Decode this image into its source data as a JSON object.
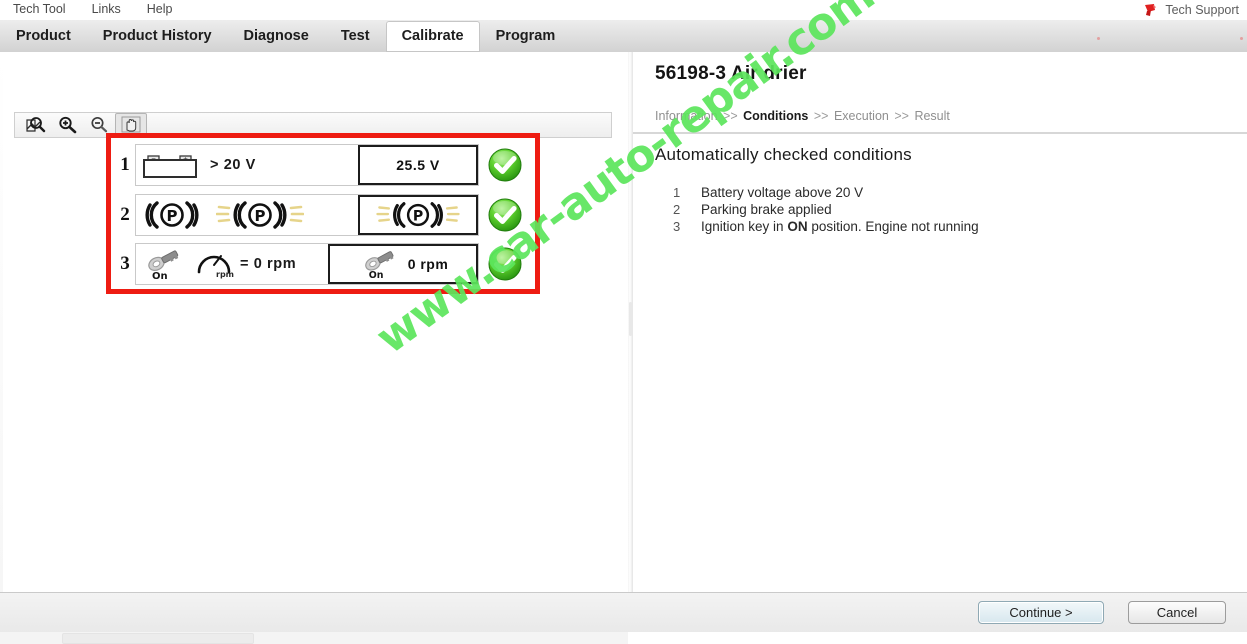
{
  "menubar": {
    "items": [
      {
        "label": "Tech Tool"
      },
      {
        "label": "Links"
      },
      {
        "label": "Help"
      }
    ],
    "tech_support": {
      "label": "Tech Support",
      "icon": "tech-support-icon"
    }
  },
  "tabs": [
    {
      "label": "Product",
      "active": false
    },
    {
      "label": "Product History",
      "active": false
    },
    {
      "label": "Diagnose",
      "active": false
    },
    {
      "label": "Test",
      "active": false
    },
    {
      "label": "Calibrate",
      "active": true
    },
    {
      "label": "Program",
      "active": false
    }
  ],
  "graphic_toolbar": {
    "buttons": [
      {
        "name": "zoom-fit-icon",
        "title": "Zoom to fit"
      },
      {
        "name": "zoom-in-icon",
        "title": "Zoom in"
      },
      {
        "name": "zoom-out-icon",
        "title": "Zoom out"
      },
      {
        "name": "pan-hand-icon",
        "title": "Pan"
      }
    ]
  },
  "conditions_graphic": {
    "highlight_color": "#ee1c12",
    "status_ok_color": "#3fbe2a",
    "rows": [
      {
        "index": "1",
        "requirement_icon": "battery-icon",
        "requirement_text": "> 20 V",
        "measured_icon": "",
        "measured_text": "25.5 V",
        "status": "ok"
      },
      {
        "index": "2",
        "requirement_icon": "parking-brake-icon",
        "requirement_text": "",
        "measured_icon": "parking-brake-lit-icon",
        "measured_text": "",
        "status": "ok"
      },
      {
        "index": "3",
        "requirement_icon": "ignition-key-on-icon",
        "requirement_text": "= 0 rpm",
        "requirement_gauge_label": "rpm",
        "requirement_key_label": "On",
        "measured_icon": "ignition-key-on-icon",
        "measured_key_label": "On",
        "measured_text": "0 rpm",
        "status": "ok"
      }
    ]
  },
  "document": {
    "title": "56198-3 Air drier",
    "breadcrumb": [
      {
        "label": "Information",
        "active": false
      },
      {
        "label": "Conditions",
        "active": true
      },
      {
        "label": "Execution",
        "active": false
      },
      {
        "label": "Result",
        "active": false
      }
    ],
    "breadcrumb_separator": ">>",
    "section_title": "Automatically checked conditions",
    "conditions": [
      {
        "num": "1",
        "text": "Battery voltage above 20 V",
        "bold_part": ""
      },
      {
        "num": "2",
        "text": "Parking brake applied",
        "bold_part": ""
      },
      {
        "num": "3",
        "text_before": "Ignition key in ",
        "bold_part": "ON",
        "text_after": " position. Engine not running"
      }
    ]
  },
  "footer": {
    "continue_label": "Continue >",
    "cancel_label": "Cancel"
  },
  "watermark": {
    "text": "www.car-auto-repair.com",
    "color": "#5ce65c"
  }
}
